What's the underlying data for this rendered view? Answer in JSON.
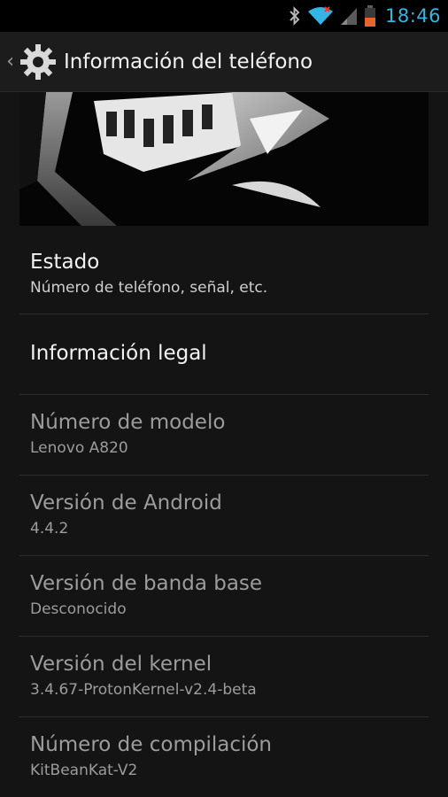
{
  "status_bar": {
    "time": "18:46",
    "icons": [
      "bluetooth-icon",
      "wifi-icon",
      "signal-icon",
      "battery-icon"
    ],
    "accent_color": "#33b5e5",
    "battery_color": "#e8642c"
  },
  "action_bar": {
    "title": "Información del teléfono",
    "icon": "settings-gear-icon",
    "up_icon": "back-caret-icon"
  },
  "items": [
    {
      "title": "Estado",
      "summary": "Número de teléfono, señal, etc.",
      "enabled": true
    },
    {
      "title": "Información legal",
      "summary": "",
      "enabled": true
    },
    {
      "title": "Número de modelo",
      "summary": "Lenovo A820",
      "enabled": false
    },
    {
      "title": "Versión de Android",
      "summary": "4.4.2",
      "enabled": false
    },
    {
      "title": "Versión de banda base",
      "summary": "Desconocido",
      "enabled": false
    },
    {
      "title": "Versión del kernel",
      "summary": "3.4.67-ProtonKernel-v2.4-beta",
      "enabled": false
    },
    {
      "title": "Número de compilación",
      "summary": "KitBeanKat-V2",
      "enabled": false
    }
  ]
}
